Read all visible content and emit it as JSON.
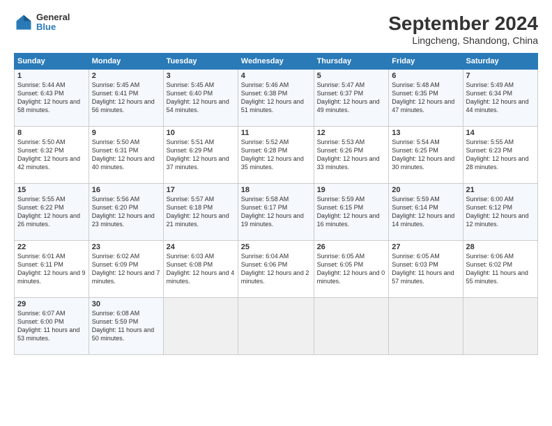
{
  "header": {
    "logo": {
      "general": "General",
      "blue": "Blue"
    },
    "title": "September 2024",
    "subtitle": "Lingcheng, Shandong, China"
  },
  "weekdays": [
    "Sunday",
    "Monday",
    "Tuesday",
    "Wednesday",
    "Thursday",
    "Friday",
    "Saturday"
  ],
  "weeks": [
    [
      {
        "day": "1",
        "sunrise": "Sunrise: 5:44 AM",
        "sunset": "Sunset: 6:43 PM",
        "daylight": "Daylight: 12 hours and 58 minutes."
      },
      {
        "day": "2",
        "sunrise": "Sunrise: 5:45 AM",
        "sunset": "Sunset: 6:41 PM",
        "daylight": "Daylight: 12 hours and 56 minutes."
      },
      {
        "day": "3",
        "sunrise": "Sunrise: 5:45 AM",
        "sunset": "Sunset: 6:40 PM",
        "daylight": "Daylight: 12 hours and 54 minutes."
      },
      {
        "day": "4",
        "sunrise": "Sunrise: 5:46 AM",
        "sunset": "Sunset: 6:38 PM",
        "daylight": "Daylight: 12 hours and 51 minutes."
      },
      {
        "day": "5",
        "sunrise": "Sunrise: 5:47 AM",
        "sunset": "Sunset: 6:37 PM",
        "daylight": "Daylight: 12 hours and 49 minutes."
      },
      {
        "day": "6",
        "sunrise": "Sunrise: 5:48 AM",
        "sunset": "Sunset: 6:35 PM",
        "daylight": "Daylight: 12 hours and 47 minutes."
      },
      {
        "day": "7",
        "sunrise": "Sunrise: 5:49 AM",
        "sunset": "Sunset: 6:34 PM",
        "daylight": "Daylight: 12 hours and 44 minutes."
      }
    ],
    [
      {
        "day": "8",
        "sunrise": "Sunrise: 5:50 AM",
        "sunset": "Sunset: 6:32 PM",
        "daylight": "Daylight: 12 hours and 42 minutes."
      },
      {
        "day": "9",
        "sunrise": "Sunrise: 5:50 AM",
        "sunset": "Sunset: 6:31 PM",
        "daylight": "Daylight: 12 hours and 40 minutes."
      },
      {
        "day": "10",
        "sunrise": "Sunrise: 5:51 AM",
        "sunset": "Sunset: 6:29 PM",
        "daylight": "Daylight: 12 hours and 37 minutes."
      },
      {
        "day": "11",
        "sunrise": "Sunrise: 5:52 AM",
        "sunset": "Sunset: 6:28 PM",
        "daylight": "Daylight: 12 hours and 35 minutes."
      },
      {
        "day": "12",
        "sunrise": "Sunrise: 5:53 AM",
        "sunset": "Sunset: 6:26 PM",
        "daylight": "Daylight: 12 hours and 33 minutes."
      },
      {
        "day": "13",
        "sunrise": "Sunrise: 5:54 AM",
        "sunset": "Sunset: 6:25 PM",
        "daylight": "Daylight: 12 hours and 30 minutes."
      },
      {
        "day": "14",
        "sunrise": "Sunrise: 5:55 AM",
        "sunset": "Sunset: 6:23 PM",
        "daylight": "Daylight: 12 hours and 28 minutes."
      }
    ],
    [
      {
        "day": "15",
        "sunrise": "Sunrise: 5:55 AM",
        "sunset": "Sunset: 6:22 PM",
        "daylight": "Daylight: 12 hours and 26 minutes."
      },
      {
        "day": "16",
        "sunrise": "Sunrise: 5:56 AM",
        "sunset": "Sunset: 6:20 PM",
        "daylight": "Daylight: 12 hours and 23 minutes."
      },
      {
        "day": "17",
        "sunrise": "Sunrise: 5:57 AM",
        "sunset": "Sunset: 6:18 PM",
        "daylight": "Daylight: 12 hours and 21 minutes."
      },
      {
        "day": "18",
        "sunrise": "Sunrise: 5:58 AM",
        "sunset": "Sunset: 6:17 PM",
        "daylight": "Daylight: 12 hours and 19 minutes."
      },
      {
        "day": "19",
        "sunrise": "Sunrise: 5:59 AM",
        "sunset": "Sunset: 6:15 PM",
        "daylight": "Daylight: 12 hours and 16 minutes."
      },
      {
        "day": "20",
        "sunrise": "Sunrise: 5:59 AM",
        "sunset": "Sunset: 6:14 PM",
        "daylight": "Daylight: 12 hours and 14 minutes."
      },
      {
        "day": "21",
        "sunrise": "Sunrise: 6:00 AM",
        "sunset": "Sunset: 6:12 PM",
        "daylight": "Daylight: 12 hours and 12 minutes."
      }
    ],
    [
      {
        "day": "22",
        "sunrise": "Sunrise: 6:01 AM",
        "sunset": "Sunset: 6:11 PM",
        "daylight": "Daylight: 12 hours and 9 minutes."
      },
      {
        "day": "23",
        "sunrise": "Sunrise: 6:02 AM",
        "sunset": "Sunset: 6:09 PM",
        "daylight": "Daylight: 12 hours and 7 minutes."
      },
      {
        "day": "24",
        "sunrise": "Sunrise: 6:03 AM",
        "sunset": "Sunset: 6:08 PM",
        "daylight": "Daylight: 12 hours and 4 minutes."
      },
      {
        "day": "25",
        "sunrise": "Sunrise: 6:04 AM",
        "sunset": "Sunset: 6:06 PM",
        "daylight": "Daylight: 12 hours and 2 minutes."
      },
      {
        "day": "26",
        "sunrise": "Sunrise: 6:05 AM",
        "sunset": "Sunset: 6:05 PM",
        "daylight": "Daylight: 12 hours and 0 minutes."
      },
      {
        "day": "27",
        "sunrise": "Sunrise: 6:05 AM",
        "sunset": "Sunset: 6:03 PM",
        "daylight": "Daylight: 11 hours and 57 minutes."
      },
      {
        "day": "28",
        "sunrise": "Sunrise: 6:06 AM",
        "sunset": "Sunset: 6:02 PM",
        "daylight": "Daylight: 11 hours and 55 minutes."
      }
    ],
    [
      {
        "day": "29",
        "sunrise": "Sunrise: 6:07 AM",
        "sunset": "Sunset: 6:00 PM",
        "daylight": "Daylight: 11 hours and 53 minutes."
      },
      {
        "day": "30",
        "sunrise": "Sunrise: 6:08 AM",
        "sunset": "Sunset: 5:59 PM",
        "daylight": "Daylight: 11 hours and 50 minutes."
      },
      null,
      null,
      null,
      null,
      null
    ]
  ]
}
